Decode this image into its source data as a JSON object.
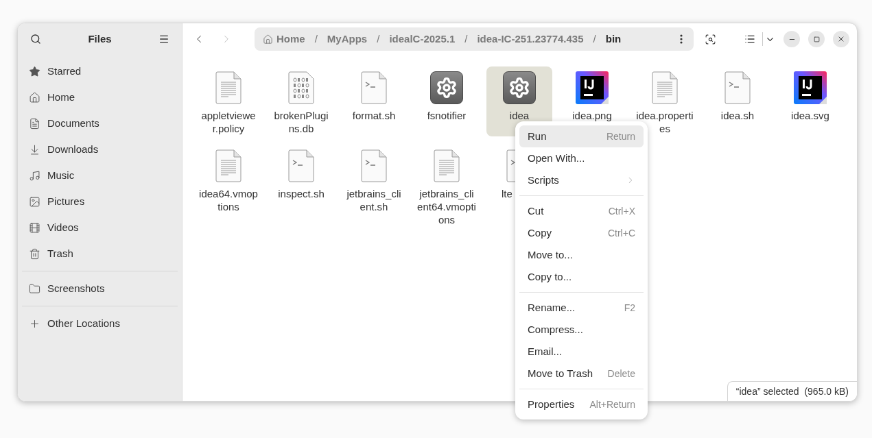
{
  "sidebar": {
    "title": "Files",
    "sections": [
      [
        {
          "label": "Starred"
        },
        {
          "label": "Home"
        },
        {
          "label": "Documents"
        },
        {
          "label": "Downloads"
        },
        {
          "label": "Music"
        },
        {
          "label": "Pictures"
        },
        {
          "label": "Videos"
        },
        {
          "label": "Trash"
        }
      ],
      [
        {
          "label": "Screenshots"
        }
      ],
      [
        {
          "label": "Other Locations"
        }
      ]
    ]
  },
  "toolbar": {
    "back_disabled": false,
    "forward_disabled": true
  },
  "path": [
    {
      "label": "Home",
      "selected": false
    },
    {
      "separator": "/",
      "label": "MyApps",
      "selected": false
    },
    {
      "separator": "/",
      "label": "idealC-2025.1",
      "selected": false
    },
    {
      "separator": "/",
      "label": "idea-IC-251.23774.435",
      "selected": false
    },
    {
      "separator": "/",
      "label": "bin",
      "selected": true
    }
  ],
  "files": [
    {
      "name": "appletviewer.policy",
      "kind": "document",
      "selected": false
    },
    {
      "name": "brokenPlugins.db",
      "kind": "binary",
      "selected": false
    },
    {
      "name": "format.sh",
      "kind": "script",
      "selected": false
    },
    {
      "name": "fsnotifier",
      "kind": "executable",
      "selected": false
    },
    {
      "name": "idea",
      "kind": "executable",
      "selected": true
    },
    {
      "name": "idea.png",
      "kind": "image",
      "selected": false
    },
    {
      "name": "idea.properties",
      "kind": "document",
      "selected": false
    },
    {
      "name": "idea.sh",
      "kind": "script",
      "selected": false
    },
    {
      "name": "idea.svg",
      "kind": "image",
      "selected": false
    },
    {
      "name": "idea64.vmoptions",
      "kind": "document",
      "selected": false
    },
    {
      "name": "inspect.sh",
      "kind": "script",
      "selected": false
    },
    {
      "name": "jetbrains_client.sh",
      "kind": "script",
      "selected": false
    },
    {
      "name": "jetbrains_client64.vmoptions",
      "kind": "document",
      "selected": false
    },
    {
      "name": "lte",
      "kind": "script",
      "selected": false,
      "covered": true
    }
  ],
  "context_menu": {
    "sections": [
      [
        {
          "label": "Run",
          "shortcut": "Return",
          "selected": true,
          "submenu": false
        },
        {
          "label": "Open With...",
          "selected": false,
          "submenu": false
        },
        {
          "label": "Scripts",
          "selected": false,
          "submenu": true
        }
      ],
      [
        {
          "label": "Cut",
          "shortcut": "Ctrl+X",
          "selected": false,
          "submenu": false
        },
        {
          "label": "Copy",
          "shortcut": "Ctrl+C",
          "selected": false,
          "submenu": false
        },
        {
          "label": "Move to...",
          "selected": false,
          "submenu": false
        },
        {
          "label": "Copy to...",
          "selected": false,
          "submenu": false
        }
      ],
      [
        {
          "label": "Rename...",
          "shortcut": "F2",
          "selected": false,
          "submenu": false
        },
        {
          "label": "Compress...",
          "selected": false,
          "submenu": false
        },
        {
          "label": "Email...",
          "selected": false,
          "submenu": false
        },
        {
          "label": "Move to Trash",
          "shortcut": "Delete",
          "selected": false,
          "submenu": false
        }
      ],
      [
        {
          "label": "Properties",
          "shortcut": "Alt+Return",
          "selected": false,
          "submenu": false
        }
      ]
    ]
  },
  "status": "“idea” selected  (965.0 kB)"
}
